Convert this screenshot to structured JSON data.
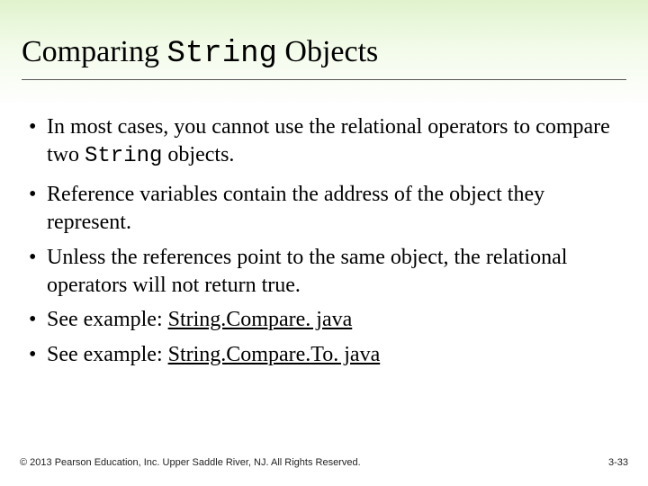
{
  "title": {
    "pre": "Comparing ",
    "mono": "String",
    "post": " Objects"
  },
  "bullets": {
    "b1_pre": "In most cases, you cannot use the relational operators to compare two ",
    "b1_mono": "String",
    "b1_post": " objects.",
    "b2": "Reference variables contain the address of the object they represent.",
    "b3": "Unless the references point to the same object, the relational operators will not return true.",
    "b4_pre": "See example: ",
    "b4_link": "String.Compare. java",
    "b5_pre": "See example: ",
    "b5_link": "String.Compare.To. java"
  },
  "footer": {
    "copyright": "© 2013 Pearson Education, Inc. Upper Saddle River, NJ. All Rights Reserved.",
    "page": "3-33"
  }
}
